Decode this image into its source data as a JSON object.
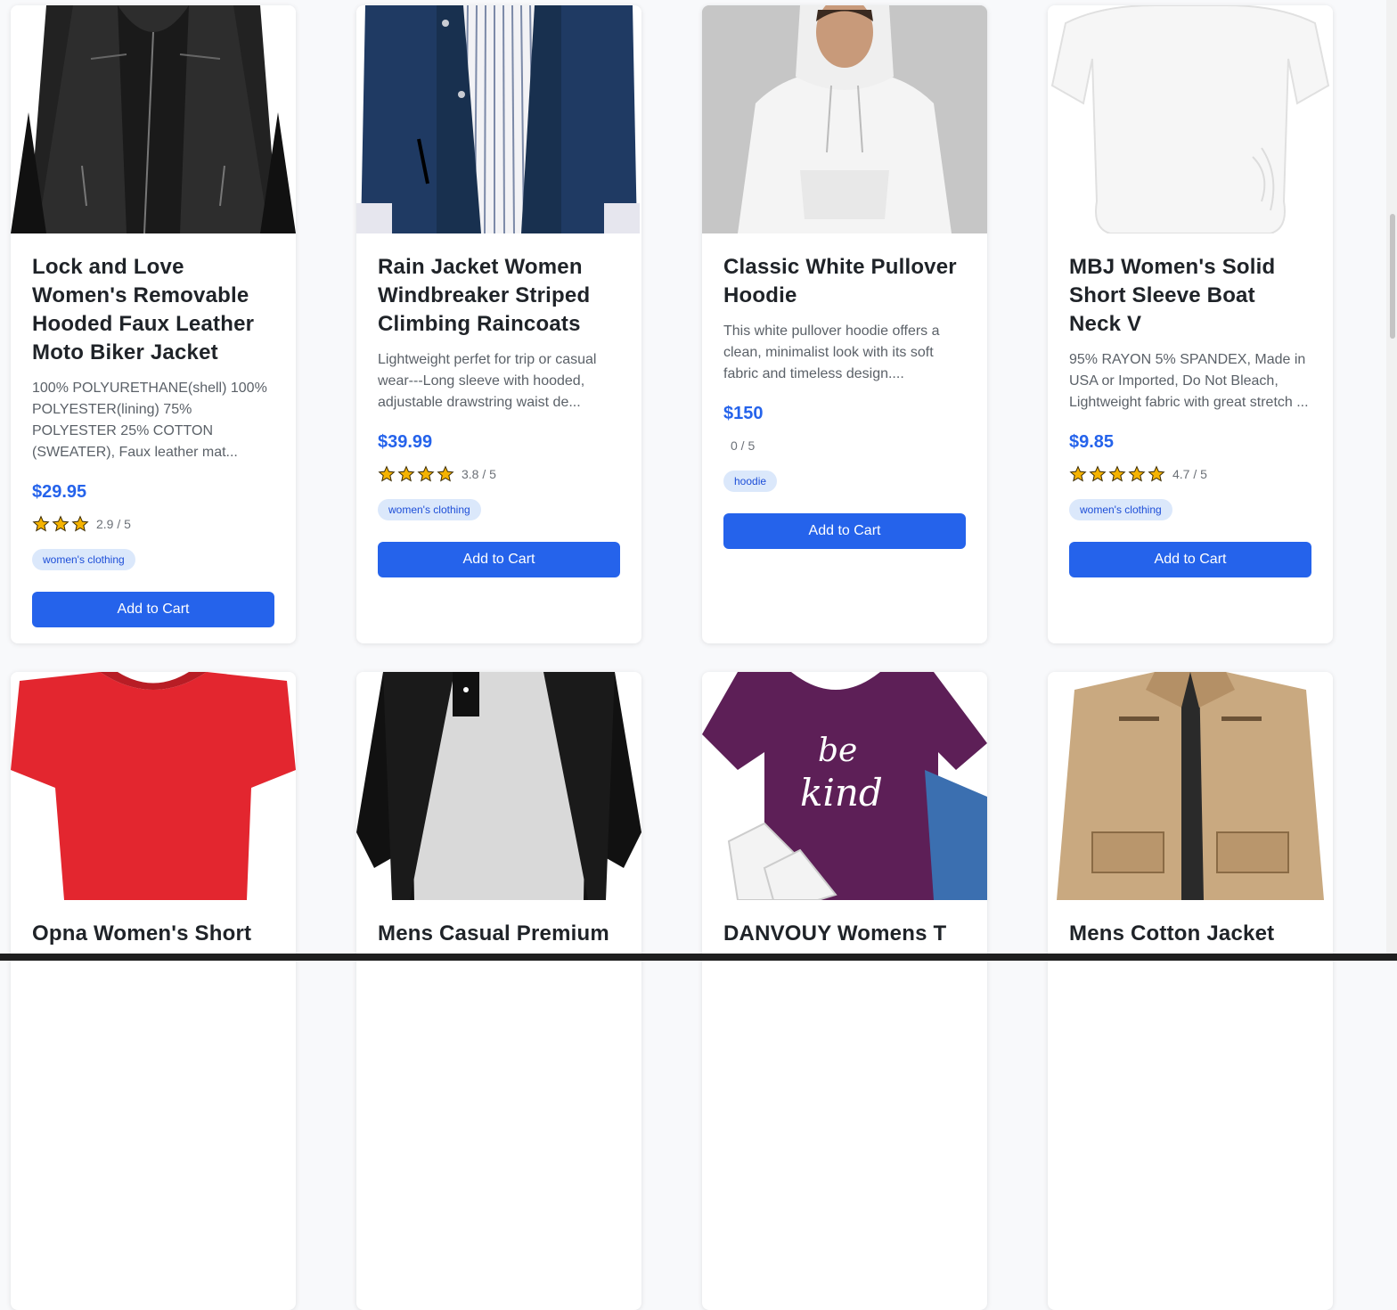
{
  "products": [
    {
      "title": "Lock and Love Women's Removable Hooded Faux Leather Moto Biker Jacket",
      "description": "100% POLYURETHANE(shell) 100% POLYESTER(lining) 75% POLYESTER 25% COTTON (SWEATER), Faux leather mat...",
      "price": "$29.95",
      "stars": 3,
      "rating_text": "2.9 / 5",
      "tag": "women's clothing",
      "button": "Add to Cart",
      "image_icon": "leather-jacket-image"
    },
    {
      "title": "Rain Jacket Women Windbreaker Striped Climbing Raincoats",
      "description": "Lightweight perfet for trip or casual wear---Long sleeve with hooded, adjustable drawstring waist de...",
      "price": "$39.99",
      "stars": 4,
      "rating_text": "3.8 / 5",
      "tag": "women's clothing",
      "button": "Add to Cart",
      "image_icon": "rain-jacket-image"
    },
    {
      "title": "Classic White Pullover Hoodie",
      "description": "This white pullover hoodie offers a clean, minimalist look with its soft fabric and timeless design....",
      "price": "$150",
      "stars": 0,
      "rating_text": "0 / 5",
      "tag": "hoodie",
      "button": "Add to Cart",
      "image_icon": "white-hoodie-image"
    },
    {
      "title": "MBJ Women's Solid Short Sleeve Boat Neck V",
      "description": "95% RAYON 5% SPANDEX, Made in USA or Imported, Do Not Bleach, Lightweight fabric with great stretch ...",
      "price": "$9.85",
      "stars": 5,
      "rating_text": "4.7 / 5",
      "tag": "women's clothing",
      "button": "Add to Cart",
      "image_icon": "white-top-image"
    },
    {
      "title": "Opna Women's Short",
      "image_icon": "red-tshirt-image"
    },
    {
      "title": "Mens Casual Premium",
      "image_icon": "raglan-tshirt-image"
    },
    {
      "title": "DANVOUY Womens T",
      "image_icon": "be-kind-tshirt-image",
      "image_text_1": "be",
      "image_text_2": "kind"
    },
    {
      "title": "Mens Cotton Jacket",
      "image_icon": "cotton-jacket-image"
    }
  ],
  "colors": {
    "accent": "#2563eb",
    "tag_bg": "#dbe8fb",
    "star": "#f5b301"
  }
}
